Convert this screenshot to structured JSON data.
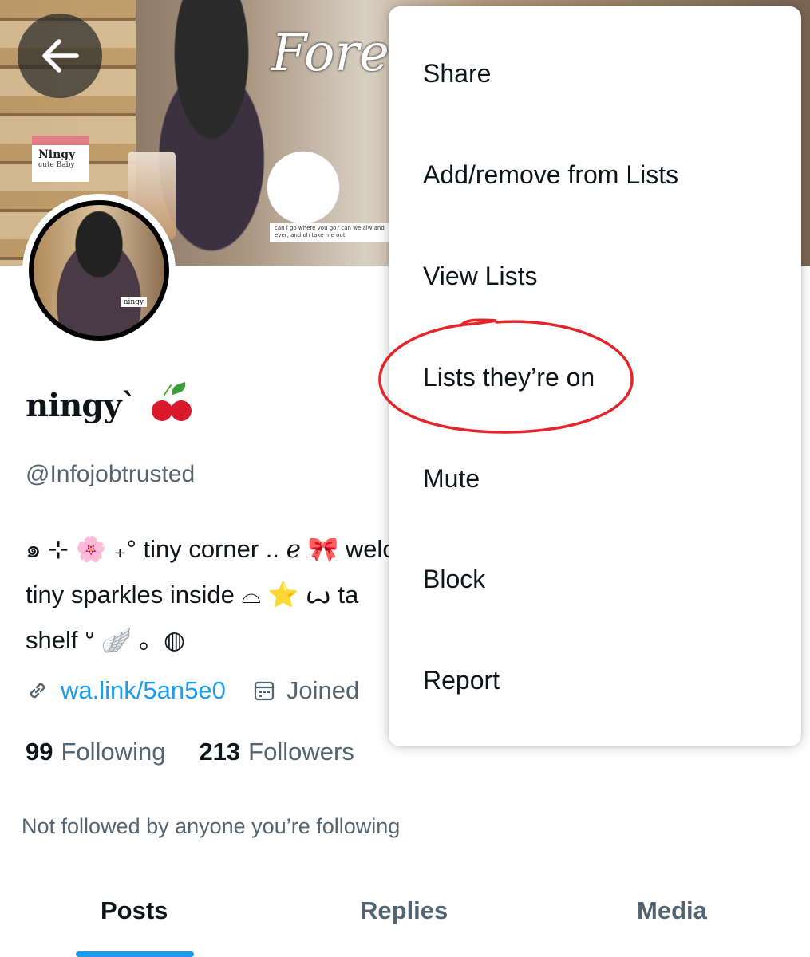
{
  "header": {
    "back_icon": "arrow-left-icon",
    "banner": {
      "script_text": "Fore alw",
      "sticker_line1": "Ningy",
      "sticker_line2": "cute Baby",
      "caption": "can i go where you go? can we alw and ever, and oh take me out"
    },
    "avatar_tag": "ningy"
  },
  "profile": {
    "display_name": "ningy`",
    "name_emoji_icon": "cherry-icon",
    "handle": "@Infojobtrusted",
    "bio_lines": [
      "๑ ⊹ 🌸 ₊° tiny corner .. ℯ 🎀 welc",
      "tiny sparkles inside ⌓ ⭐ ꙍ ta",
      "shelf ᐡ 🪽 。◍"
    ],
    "link_icon": "link-icon",
    "website": "wa.link/5an5e0",
    "calendar_icon": "calendar-icon",
    "joined": "Joined",
    "following_count": "99",
    "following_label": "Following",
    "followers_count": "213",
    "followers_label": "Followers",
    "not_followed": "Not followed by anyone you’re following"
  },
  "tabs": [
    {
      "label": "Posts",
      "active": true
    },
    {
      "label": "Replies",
      "active": false
    },
    {
      "label": "Media",
      "active": false
    }
  ],
  "menu": {
    "items": [
      "Share",
      "Add/remove from Lists",
      "View Lists",
      "Lists they’re on",
      "Mute",
      "Block",
      "Report"
    ],
    "highlighted_item": "Lists they’re on",
    "highlight_color": "#e4262c"
  },
  "colors": {
    "accent": "#1d9bf0",
    "secondary_text": "#536471",
    "primary_text": "#0f1419"
  }
}
